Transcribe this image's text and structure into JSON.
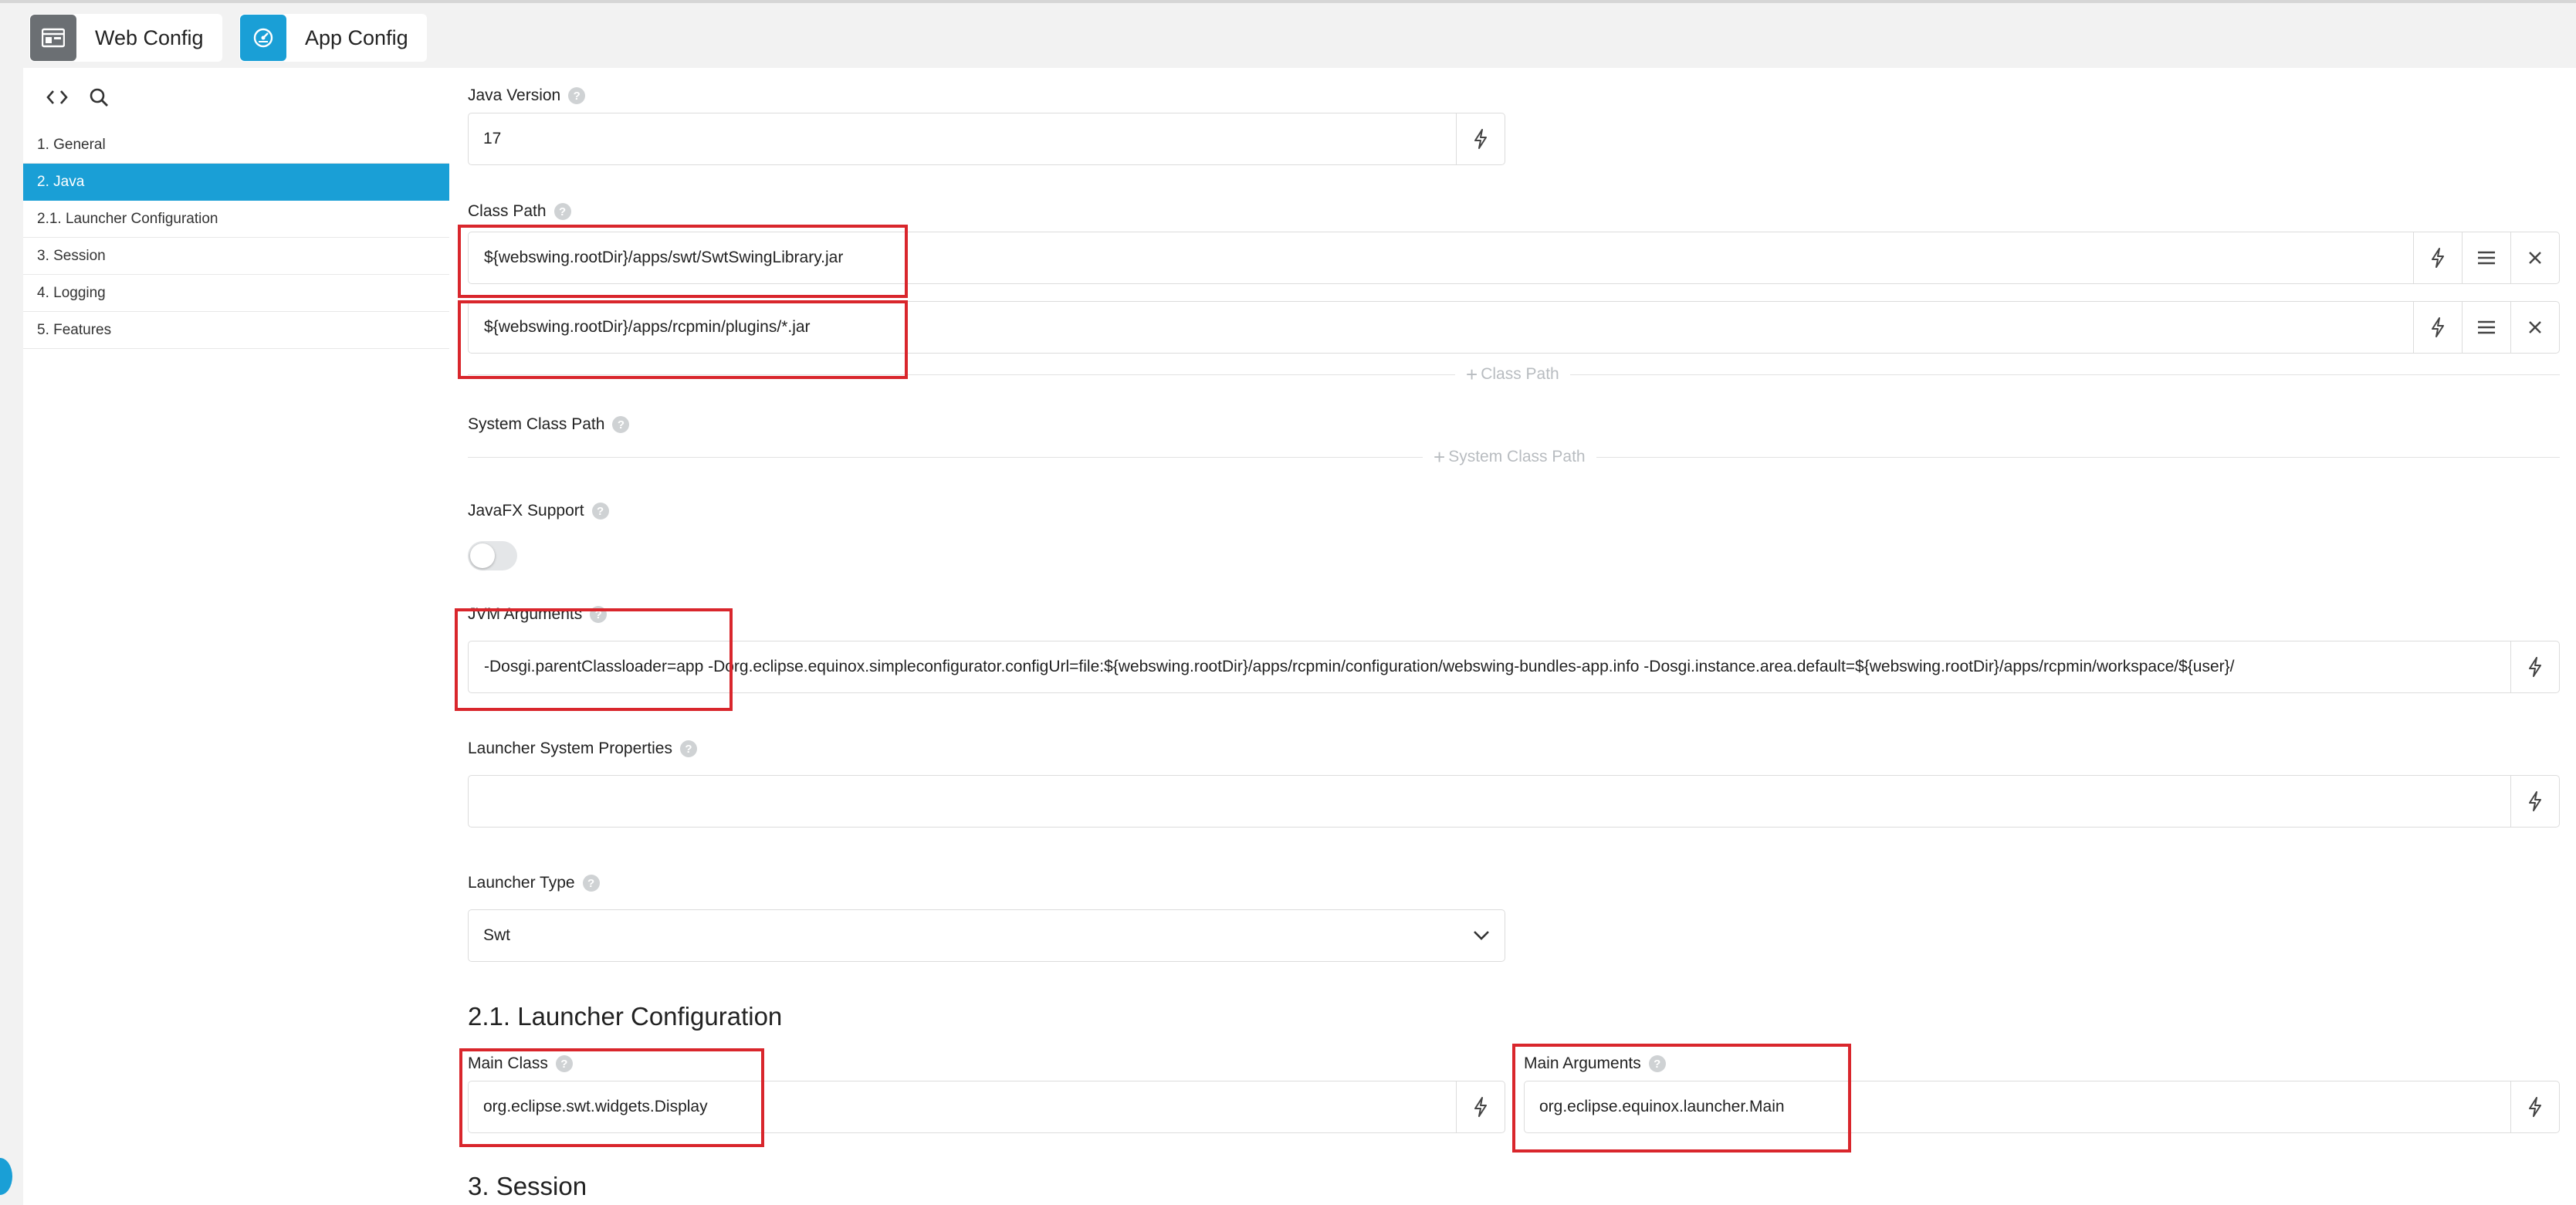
{
  "tabs": {
    "web_config": "Web Config",
    "app_config": "App Config"
  },
  "sidebar": {
    "items": [
      {
        "label": "1. General",
        "active": false
      },
      {
        "label": "2. Java",
        "active": true
      },
      {
        "label": "2.1. Launcher Configuration",
        "active": false
      },
      {
        "label": "3. Session",
        "active": false
      },
      {
        "label": "4. Logging",
        "active": false
      },
      {
        "label": "5. Features",
        "active": false
      }
    ]
  },
  "form": {
    "java_version": {
      "label": "Java Version",
      "value": "17"
    },
    "class_path": {
      "label": "Class Path",
      "entries": [
        "${webswing.rootDir}/apps/swt/SwtSwingLibrary.jar",
        "${webswing.rootDir}/apps/rcpmin/plugins/*.jar"
      ],
      "add_label": "Class Path"
    },
    "system_class_path": {
      "label": "System Class Path",
      "add_label": "System Class Path"
    },
    "javafx_support": {
      "label": "JavaFX Support",
      "enabled": false
    },
    "jvm_arguments": {
      "label": "JVM Arguments",
      "value": "-Dosgi.parentClassloader=app -Dorg.eclipse.equinox.simpleconfigurator.configUrl=file:${webswing.rootDir}/apps/rcpmin/configuration/webswing-bundles-app.info -Dosgi.instance.area.default=${webswing.rootDir}/apps/rcpmin/workspace/${user}/"
    },
    "launcher_system_properties": {
      "label": "Launcher System Properties",
      "value": ""
    },
    "launcher_type": {
      "label": "Launcher Type",
      "value": "Swt"
    }
  },
  "launcher_section": {
    "title": "2.1. Launcher Configuration",
    "main_class": {
      "label": "Main Class",
      "value": "org.eclipse.swt.widgets.Display"
    },
    "main_arguments": {
      "label": "Main Arguments",
      "value": "org.eclipse.equinox.launcher.Main"
    }
  },
  "session_section": {
    "title": "3. Session"
  },
  "colors": {
    "accent": "#1a9fd6",
    "highlight_box": "#d9262c",
    "web_tab_icon": "#6b6f73"
  },
  "icons": {
    "web_config": "browser-window-icon",
    "app_config": "app-gauge-icon",
    "code": "code-brackets-icon",
    "search": "search-icon",
    "variable": "lightning-icon",
    "reorder": "hamburger-icon",
    "remove": "close-icon",
    "dropdown": "chevron-down-icon",
    "help": "help-circle-icon"
  }
}
